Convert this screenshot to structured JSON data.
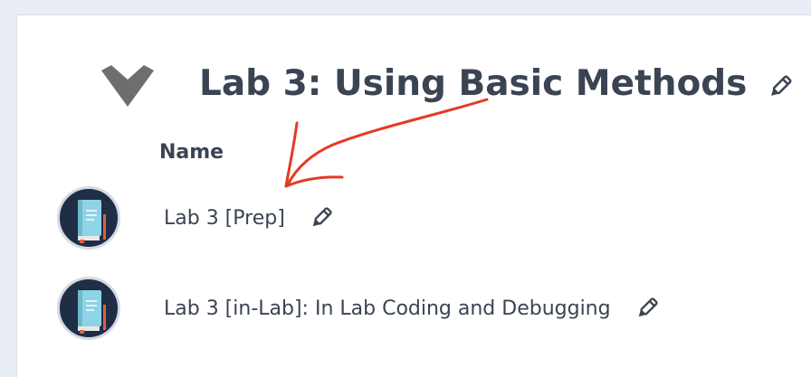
{
  "section": {
    "title": "Lab 3: Using Basic Methods",
    "collapse_icon": "chevron-down-icon",
    "edit_icon": "pencil-icon"
  },
  "table": {
    "name_header": "Name",
    "rows": [
      {
        "label": "Lab 3 [Prep]",
        "icon": "book-icon",
        "edit_icon": "pencil-icon"
      },
      {
        "label": "Lab 3 [in-Lab]: In Lab Coding and Debugging",
        "icon": "book-icon",
        "edit_icon": "pencil-icon"
      }
    ]
  },
  "colors": {
    "text": "#3a4453",
    "chevron": "#6e6e6e",
    "avatar_bg": "#1f2d45",
    "book": "#8fd3e6",
    "annotation": "#e53a25"
  }
}
